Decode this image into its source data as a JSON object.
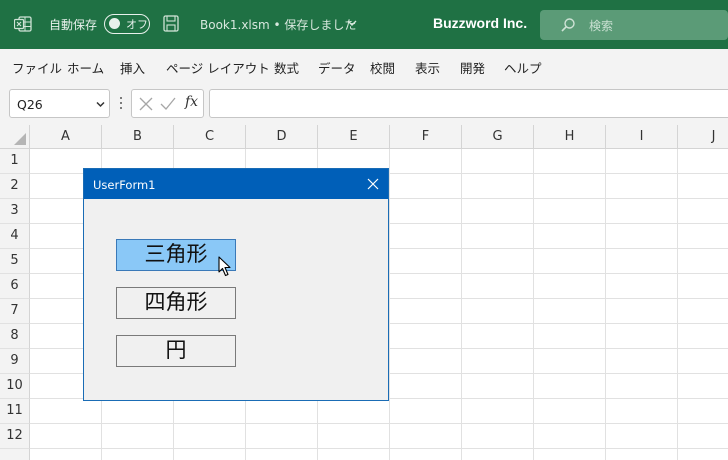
{
  "title_bar": {
    "autosave_label": "自動保存",
    "autosave_state": "オフ",
    "filename": "Book1.xlsm • 保存しました",
    "company": "Buzzword Inc.",
    "search_placeholder": "検索",
    "background_color": "#1f7144"
  },
  "menu": {
    "items": [
      "ファイル",
      "ホーム",
      "挿入",
      "ページ レイアウト",
      "数式",
      "データ",
      "校閲",
      "表示",
      "開発",
      "ヘルプ"
    ]
  },
  "formula_bar": {
    "name_box": "Q26",
    "fx_label": "fx",
    "formula_value": ""
  },
  "sheet": {
    "columns": [
      "A",
      "B",
      "C",
      "D",
      "E",
      "F",
      "G",
      "H",
      "I",
      "J"
    ],
    "rows": [
      "1",
      "2",
      "3",
      "4",
      "5",
      "6",
      "7",
      "8",
      "9",
      "10",
      "11",
      "12"
    ]
  },
  "userform": {
    "title": "UserForm1",
    "buttons": [
      {
        "label": "三角形",
        "state": "hover"
      },
      {
        "label": "四角形",
        "state": "normal"
      },
      {
        "label": "円",
        "state": "normal"
      }
    ],
    "title_color": "#005fb8",
    "hover_color": "#8ac8f7"
  }
}
